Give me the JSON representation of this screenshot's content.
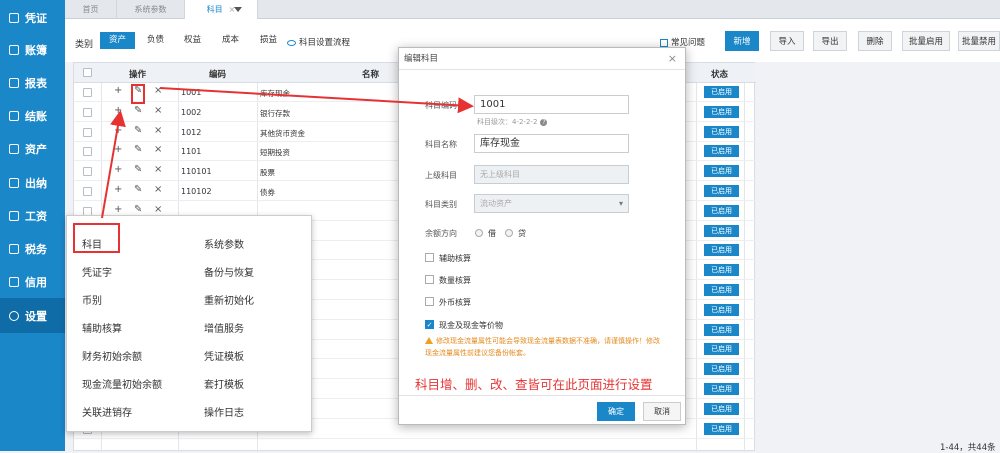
{
  "sidebar": {
    "items": [
      {
        "label": "凭证"
      },
      {
        "label": "账簿"
      },
      {
        "label": "报表"
      },
      {
        "label": "结账"
      },
      {
        "label": "资产"
      },
      {
        "label": "出纳"
      },
      {
        "label": "工资"
      },
      {
        "label": "税务"
      },
      {
        "label": "信用"
      },
      {
        "label": "设置"
      }
    ]
  },
  "tabs": [
    {
      "label": "首页"
    },
    {
      "label": "系统参数"
    },
    {
      "label": "科目"
    }
  ],
  "toolbar": {
    "category_label": "类别",
    "categories": [
      {
        "label": "资产"
      },
      {
        "label": "负债"
      },
      {
        "label": "权益"
      },
      {
        "label": "成本"
      },
      {
        "label": "损益"
      }
    ],
    "flow_link": "科目设置流程",
    "faq": "常见问题",
    "buttons": [
      {
        "label": "新增"
      },
      {
        "label": "导入"
      },
      {
        "label": "导出"
      },
      {
        "label": "删除"
      },
      {
        "label": "批量启用"
      },
      {
        "label": "批量禁用"
      }
    ]
  },
  "grid": {
    "headers": {
      "op": "操作",
      "code": "编码",
      "name": "名称",
      "status": "状态"
    },
    "rows": [
      {
        "code": "1001",
        "name": "库存现金"
      },
      {
        "code": "1002",
        "name": "银行存款"
      },
      {
        "code": "1012",
        "name": "其他货币资金"
      },
      {
        "code": "1101",
        "name": "短期投资"
      },
      {
        "code": "110101",
        "name": "股票"
      },
      {
        "code": "110102",
        "name": "债券"
      }
    ],
    "status_label": "已启用",
    "status_count": 18,
    "pager": "1-44，共44条"
  },
  "popup": {
    "left": [
      {
        "label": "科目"
      },
      {
        "label": "凭证字"
      },
      {
        "label": "币别"
      },
      {
        "label": "辅助核算"
      },
      {
        "label": "财务初始余额"
      },
      {
        "label": "现金流量初始余额"
      },
      {
        "label": "关联进销存"
      }
    ],
    "right": [
      {
        "label": "系统参数"
      },
      {
        "label": "备份与恢复"
      },
      {
        "label": "重新初始化"
      },
      {
        "label": "增值服务"
      },
      {
        "label": "凭证模板"
      },
      {
        "label": "套打模板"
      },
      {
        "label": "操作日志"
      }
    ]
  },
  "dialog": {
    "title": "编辑科目",
    "code_label": "科目编码",
    "code_value": "1001",
    "level_hint": "科目级次：4-2-2-2",
    "name_label": "科目名称",
    "name_value": "库存现金",
    "parent_label": "上级科目",
    "parent_placeholder": "无上级科目",
    "type_label": "科目类别",
    "type_value": "流动资产",
    "direction_label": "余额方向",
    "debit": "借",
    "credit": "贷",
    "aux": "辅助核算",
    "qty": "数量核算",
    "fx": "外币核算",
    "cash": "现金及现金等价物",
    "warning": "修改现金流量属性可能会导致现金流量表数据不准确，请谨慎操作！修改现金流量属性前建议您备份帐套。",
    "note": "科目增、删、改、查皆可在此页面进行设置",
    "ok": "确定",
    "cancel": "取消"
  }
}
